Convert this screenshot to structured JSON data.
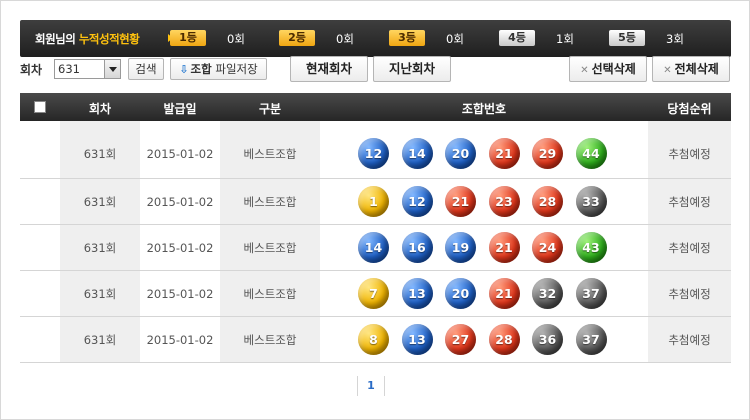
{
  "summary": {
    "prefix": "회원님의 ",
    "highlight": "누적성적현황",
    "ranks": [
      {
        "label": "1등",
        "count": "0회",
        "style": "gold"
      },
      {
        "label": "2등",
        "count": "0회",
        "style": "gold"
      },
      {
        "label": "3등",
        "count": "0회",
        "style": "gold"
      },
      {
        "label": "4등",
        "count": "1회",
        "style": "grey"
      },
      {
        "label": "5등",
        "count": "3회",
        "style": "grey"
      }
    ]
  },
  "toolbar": {
    "round_label": "회차",
    "round_select": "631",
    "search_label": "검색",
    "save_bold": "조합",
    "save_rest": " 파일저장",
    "current_round": "현재회차",
    "past_round": "지난회차",
    "delete_selected": "선택삭제",
    "delete_all": "전체삭제"
  },
  "table": {
    "headers": {
      "round": "회차",
      "issued": "발급일",
      "type": "구분",
      "numbers": "조합번호",
      "rank": "당첨순위"
    },
    "rows": [
      {
        "round": "631회",
        "date": "2015-01-02",
        "type": "베스트조합",
        "rank": "추첨예정",
        "numbers": [
          {
            "n": "12",
            "c": "b"
          },
          {
            "n": "14",
            "c": "b"
          },
          {
            "n": "20",
            "c": "b"
          },
          {
            "n": "21",
            "c": "r"
          },
          {
            "n": "29",
            "c": "r"
          },
          {
            "n": "44",
            "c": "g"
          }
        ]
      },
      {
        "round": "631회",
        "date": "2015-01-02",
        "type": "베스트조합",
        "rank": "추첨예정",
        "numbers": [
          {
            "n": "1",
            "c": "y"
          },
          {
            "n": "12",
            "c": "b"
          },
          {
            "n": "21",
            "c": "r"
          },
          {
            "n": "23",
            "c": "r"
          },
          {
            "n": "28",
            "c": "r"
          },
          {
            "n": "33",
            "c": "k"
          }
        ]
      },
      {
        "round": "631회",
        "date": "2015-01-02",
        "type": "베스트조합",
        "rank": "추첨예정",
        "numbers": [
          {
            "n": "14",
            "c": "b"
          },
          {
            "n": "16",
            "c": "b"
          },
          {
            "n": "19",
            "c": "b"
          },
          {
            "n": "21",
            "c": "r"
          },
          {
            "n": "24",
            "c": "r"
          },
          {
            "n": "43",
            "c": "g"
          }
        ]
      },
      {
        "round": "631회",
        "date": "2015-01-02",
        "type": "베스트조합",
        "rank": "추첨예정",
        "numbers": [
          {
            "n": "7",
            "c": "y"
          },
          {
            "n": "13",
            "c": "b"
          },
          {
            "n": "20",
            "c": "b"
          },
          {
            "n": "21",
            "c": "r"
          },
          {
            "n": "32",
            "c": "k"
          },
          {
            "n": "37",
            "c": "k"
          }
        ]
      },
      {
        "round": "631회",
        "date": "2015-01-02",
        "type": "베스트조합",
        "rank": "추첨예정",
        "numbers": [
          {
            "n": "8",
            "c": "y"
          },
          {
            "n": "13",
            "c": "b"
          },
          {
            "n": "27",
            "c": "r"
          },
          {
            "n": "28",
            "c": "r"
          },
          {
            "n": "36",
            "c": "k"
          },
          {
            "n": "37",
            "c": "k"
          }
        ]
      }
    ]
  },
  "pagination": {
    "current": "1"
  }
}
